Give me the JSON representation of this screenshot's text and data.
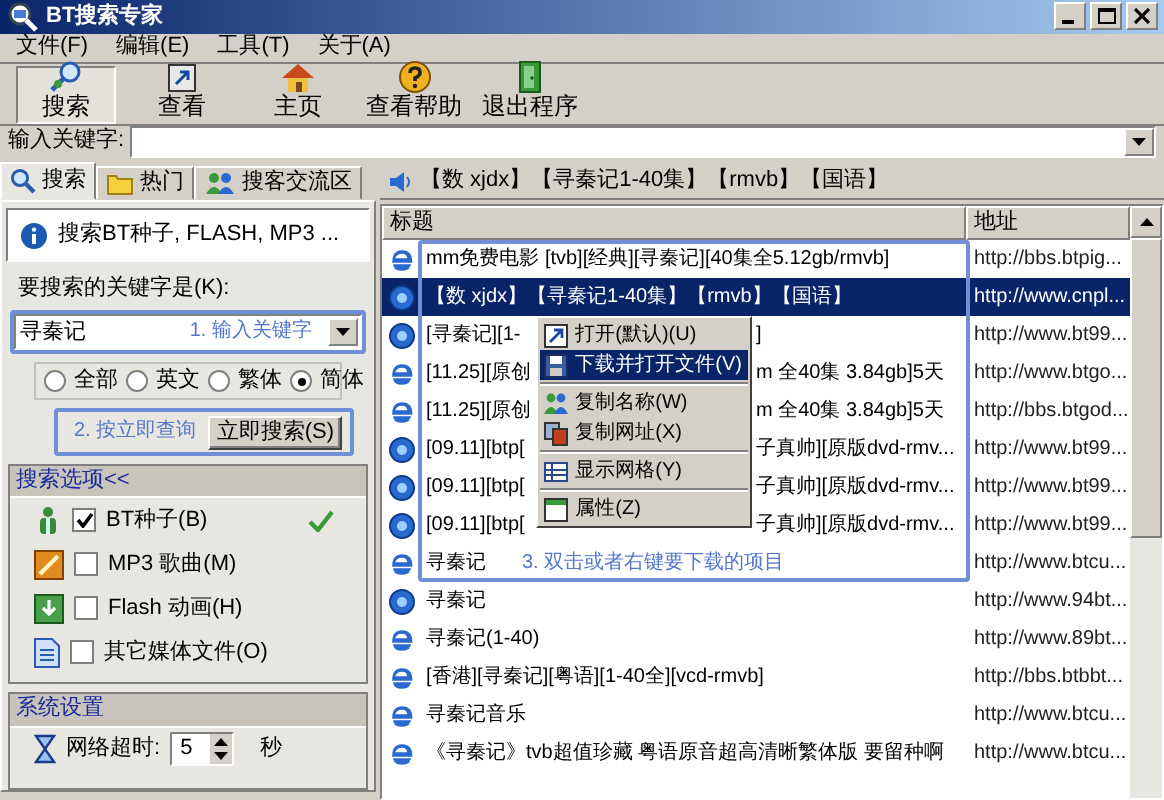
{
  "window": {
    "title": "BT搜索专家"
  },
  "menu": [
    "文件(F)",
    "编辑(E)",
    "工具(T)",
    "关于(A)"
  ],
  "toolbar": [
    {
      "label": "搜索",
      "kind": "search",
      "selected": true
    },
    {
      "label": "查看",
      "kind": "view",
      "selected": false
    },
    {
      "label": "主页",
      "kind": "home",
      "selected": false
    },
    {
      "label": "查看帮助",
      "kind": "help",
      "selected": false
    },
    {
      "label": "退出程序",
      "kind": "exit",
      "selected": false
    }
  ],
  "keyword_bar": {
    "label": "输入关键字:"
  },
  "left_tabs": [
    {
      "label": "搜索",
      "kind": "search",
      "selected": true
    },
    {
      "label": "热门",
      "kind": "folder",
      "selected": false
    },
    {
      "label": "搜客交流区",
      "kind": "people",
      "selected": false
    }
  ],
  "info": "搜索BT种子, FLASH, MP3 ...",
  "search_form": {
    "label": "要搜索的关键字是(K):",
    "value": "寻秦记",
    "hint": "1. 输入关键字",
    "language_options": [
      {
        "label": "全部",
        "selected": false
      },
      {
        "label": "英文",
        "selected": false
      },
      {
        "label": "繁体",
        "selected": false
      },
      {
        "label": "简体",
        "selected": true
      }
    ],
    "button_hint": "2. 按立即查询",
    "button": "立即搜索(S)"
  },
  "options_group": {
    "title": "搜索选项<<",
    "items": [
      {
        "label": "BT种子(B)",
        "kind": "bt",
        "checked": true
      },
      {
        "label": "MP3 歌曲(M)",
        "kind": "mp3",
        "checked": false
      },
      {
        "label": "Flash 动画(H)",
        "kind": "flash",
        "checked": false
      },
      {
        "label": "其它媒体文件(O)",
        "kind": "other",
        "checked": false
      }
    ]
  },
  "settings_group": {
    "title": "系统设置",
    "timeout_label": "网络超时:",
    "timeout_value": "5",
    "timeout_unit": "秒"
  },
  "current_title": "【数 xjdx】【寻秦记1-40集】【rmvb】【国语】",
  "results": {
    "columns": [
      "标题",
      "地址"
    ],
    "rows": [
      {
        "kind": "ie",
        "title": "mm免费电影 [tvb][经典][寻秦记][40集全5.12gb/rmvb]",
        "url": "http://bbs.btpig...",
        "selected": false
      },
      {
        "kind": "globe",
        "title": "【数 xjdx】【寻秦记1-40集】【rmvb】【国语】",
        "url": "http://www.cnpl...",
        "selected": true
      },
      {
        "kind": "globe",
        "title": "[寻秦记][1-",
        "title_end": "]",
        "url": "http://www.bt99...",
        "selected": false
      },
      {
        "kind": "ie",
        "title": "[11.25][原创",
        "title_end": "m 全40集 3.84gb]5天",
        "url": "http://www.btgo...",
        "selected": false
      },
      {
        "kind": "ie",
        "title": "[11.25][原创",
        "title_end": "m 全40集 3.84gb]5天",
        "url": "http://bbs.btgod...",
        "selected": false
      },
      {
        "kind": "globe",
        "title": "[09.11][btp[",
        "title_end": "子真帅][原版dvd-rmv...",
        "url": "http://www.bt99...",
        "selected": false
      },
      {
        "kind": "globe",
        "title": "[09.11][btp[",
        "title_end": "子真帅][原版dvd-rmv...",
        "url": "http://www.bt99...",
        "selected": false
      },
      {
        "kind": "globe",
        "title": "[09.11][btp[",
        "title_end": "子真帅][原版dvd-rmv...",
        "url": "http://www.bt99...",
        "selected": false
      },
      {
        "kind": "ie",
        "title": "寻秦记",
        "url": "http://www.btcu...",
        "selected": false
      },
      {
        "kind": "globe",
        "title": "寻秦记",
        "url": "http://www.94bt...",
        "selected": false
      },
      {
        "kind": "ie",
        "title": "寻秦记(1-40)",
        "url": "http://www.89bt...",
        "selected": false
      },
      {
        "kind": "ie",
        "title": "[香港][寻秦记][粤语][1-40全][vcd-rmvb]",
        "url": "http://bbs.btbbt...",
        "selected": false
      },
      {
        "kind": "ie",
        "title": "寻秦记音乐",
        "url": "http://www.btcu...",
        "selected": false
      },
      {
        "kind": "ie",
        "title": "《寻秦记》tvb超值珍藏 粤语原音超高清晰繁体版 要留种啊",
        "url": "http://www.btcu...",
        "selected": false
      }
    ],
    "hint": "3. 双击或者右键要下载的项目"
  },
  "context_menu": [
    {
      "kind": "open",
      "label": "打开(默认)(U)",
      "selected": false
    },
    {
      "kind": "download",
      "label": "下载并打开文件(V)",
      "selected": true
    },
    {
      "kind": "separator"
    },
    {
      "kind": "copy_name",
      "label": "复制名称(W)",
      "selected": false
    },
    {
      "kind": "copy_url",
      "label": "复制网址(X)",
      "selected": false
    },
    {
      "kind": "separator"
    },
    {
      "kind": "grid",
      "label": "显示网格(Y)",
      "selected": false
    },
    {
      "kind": "separator"
    },
    {
      "kind": "properties",
      "label": "属性(Z)",
      "selected": false
    }
  ]
}
